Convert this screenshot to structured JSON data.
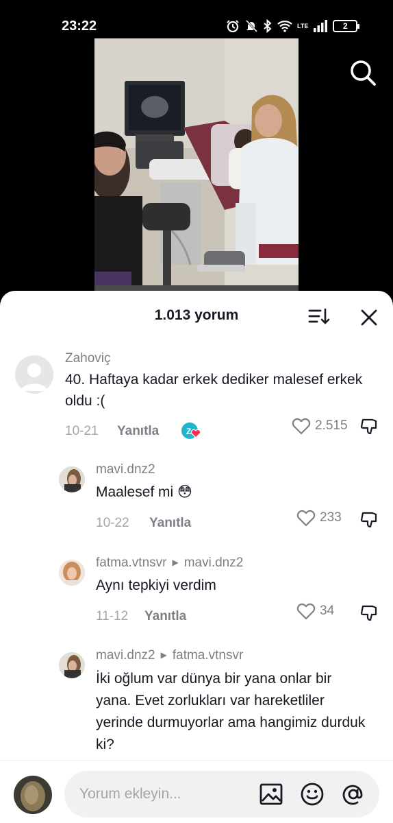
{
  "status_bar": {
    "time": "23:22",
    "battery": "2",
    "network": "LTE"
  },
  "comments_sheet": {
    "title": "1.013 yorum",
    "comments": [
      {
        "username": "Zahoviç",
        "text": "40. Haftaya kadar erkek dediker malesef erkek oldu :(",
        "date": "10-21",
        "reply_label": "Yanıtla",
        "likes": "2.515",
        "creator_liked_badge": true
      },
      {
        "username": "mavi.dnz2",
        "text": "Maalesef mi 😳",
        "date": "10-22",
        "reply_label": "Yanıtla",
        "likes": "233"
      },
      {
        "username": "fatma.vtnsvr",
        "reply_to": "mavi.dnz2",
        "text": "Aynı tepkiyi verdim",
        "date": "11-12",
        "reply_label": "Yanıtla",
        "likes": "34"
      },
      {
        "username": "mavi.dnz2",
        "reply_to": "fatma.vtnsvr",
        "text": "İki oğlum var dünya bir yana onlar bir yana. Evet zorlukları var hareketliler yerinde durmuyorlar ama hangimiz durduk ki?"
      }
    ]
  },
  "input_bar": {
    "placeholder": "Yorum ekleyin..."
  },
  "icons": {
    "search": "search-icon",
    "sort": "sort-icon",
    "close": "close-icon",
    "like": "heart-icon",
    "dislike": "thumbs-down-icon",
    "image": "image-icon",
    "emoji": "emoji-icon",
    "mention": "at-icon"
  },
  "colors": {
    "accent_pink": "#fe2c55",
    "accent_teal": "#20d5ec",
    "text_primary": "#161823",
    "text_secondary": "#7d7f86"
  }
}
